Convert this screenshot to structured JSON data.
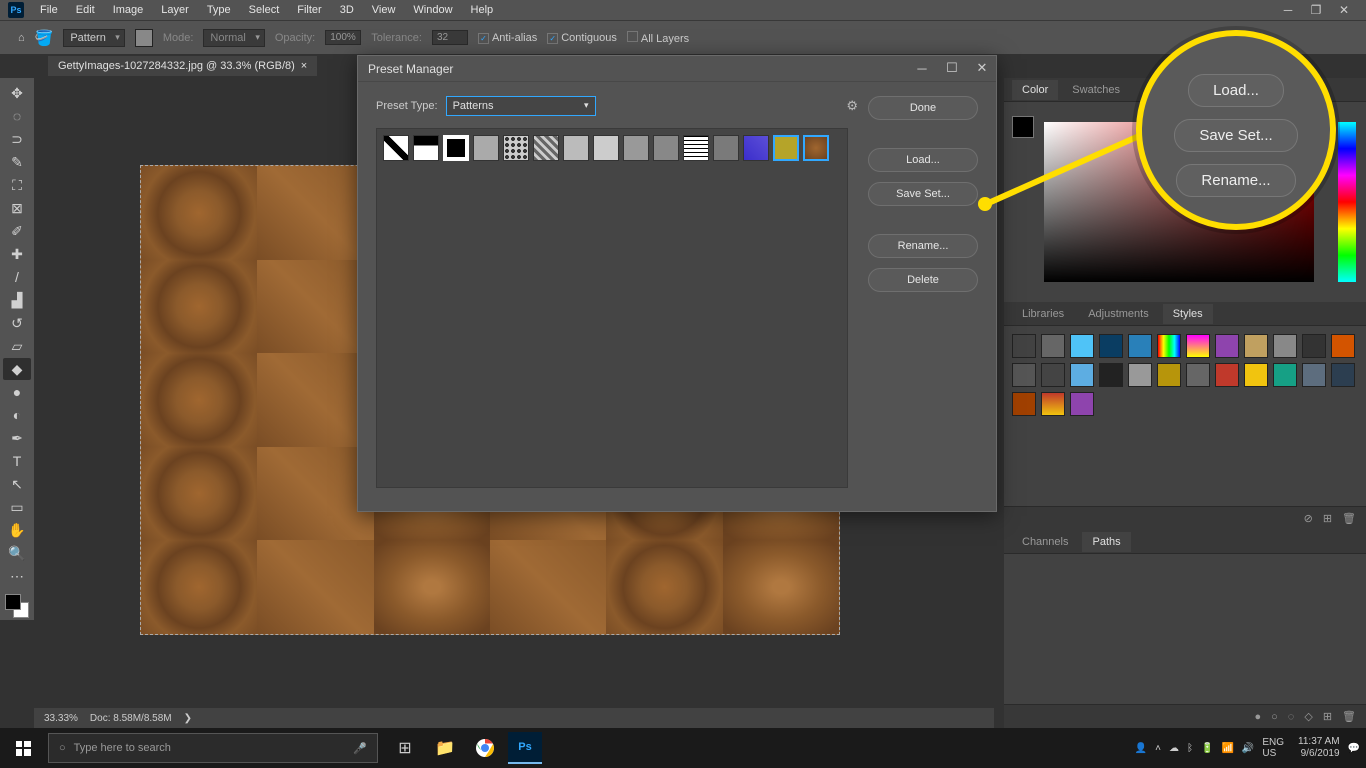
{
  "menubar": [
    "File",
    "Edit",
    "Image",
    "Layer",
    "Type",
    "Select",
    "Filter",
    "3D",
    "View",
    "Window",
    "Help"
  ],
  "options": {
    "fill_label": "Pattern",
    "mode_label": "Mode:",
    "mode_value": "Normal",
    "opacity_label": "Opacity:",
    "opacity_value": "100%",
    "tolerance_label": "Tolerance:",
    "tolerance_value": "32",
    "antialias": "Anti-alias",
    "contiguous": "Contiguous",
    "all_layers": "All Layers"
  },
  "document_tab": "GettyImages-1027284332.jpg @ 33.3% (RGB/8)",
  "dialog": {
    "title": "Preset Manager",
    "preset_type_label": "Preset Type:",
    "preset_type_value": "Patterns",
    "buttons": {
      "done": "Done",
      "load": "Load...",
      "save": "Save Set...",
      "rename": "Rename...",
      "delete": "Delete"
    }
  },
  "callout": {
    "load": "Load...",
    "save": "Save Set...",
    "rename": "Rename..."
  },
  "panels": {
    "color_tabs": [
      "Color",
      "Swatches"
    ],
    "lib_tabs": [
      "Libraries",
      "Adjustments",
      "Styles"
    ],
    "path_tabs": [
      "Channels",
      "Paths"
    ]
  },
  "status": {
    "zoom": "33.33%",
    "doc": "Doc: 8.58M/8.58M"
  },
  "taskbar": {
    "search_placeholder": "Type here to search",
    "lang": "ENG",
    "locale": "US",
    "time": "11:37 AM",
    "date": "9/6/2019"
  },
  "style_colors": [
    "#ffffff00",
    "#666",
    "#4fc3f7",
    "#0a3d62",
    "#2980b9",
    "linear-gradient(90deg,#f00,#ff0,#0f0,#0ff,#00f)",
    "linear-gradient(#f0f,#ff0)",
    "#8e44ad",
    "#c0a060",
    "#888",
    "#333",
    "#d35400",
    "#555",
    "#444",
    "#5dade2",
    "#222",
    "#999",
    "#b7950b",
    "#666",
    "#c0392b",
    "#f1c40f",
    "#16a085",
    "#5d6d7e",
    "#2c3e50",
    "#a04000",
    "linear-gradient(#c0392b,#f1c40f)",
    "#8e44ad"
  ]
}
